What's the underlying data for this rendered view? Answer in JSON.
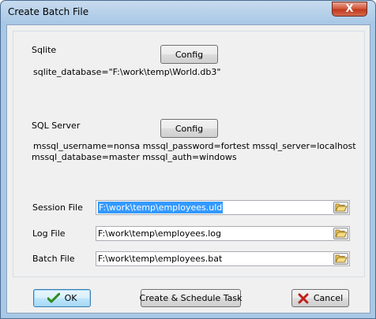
{
  "window": {
    "title": "Create Batch File",
    "close_glyph": "X"
  },
  "sqlite": {
    "label": "Sqlite",
    "config_label": "Config",
    "info": "sqlite_database=\"F:\\work\\temp\\World.db3\""
  },
  "sqlserver": {
    "label": "SQL Server",
    "config_label": "Config",
    "info_line1": "mssql_username=nonsa mssql_password=fortest mssql_server=localhost",
    "info_line2": "mssql_database=master mssql_auth=windows"
  },
  "files": {
    "session": {
      "label": "Session File",
      "value": "F:\\work\\temp\\employees.uld",
      "selected": true
    },
    "log": {
      "label": "Log File",
      "value": "F:\\work\\temp\\employees.log"
    },
    "batch": {
      "label": "Batch File",
      "value": "F:\\work\\temp\\employees.bat"
    },
    "browse_icon": "folder-open-icon"
  },
  "footer": {
    "ok_label": "OK",
    "schedule_label": "Create & Schedule Task",
    "cancel_label": "Cancel"
  },
  "colors": {
    "selection": "#3399ff",
    "ok_check": "#2e8b1e",
    "cancel_x": "#c0221b"
  }
}
